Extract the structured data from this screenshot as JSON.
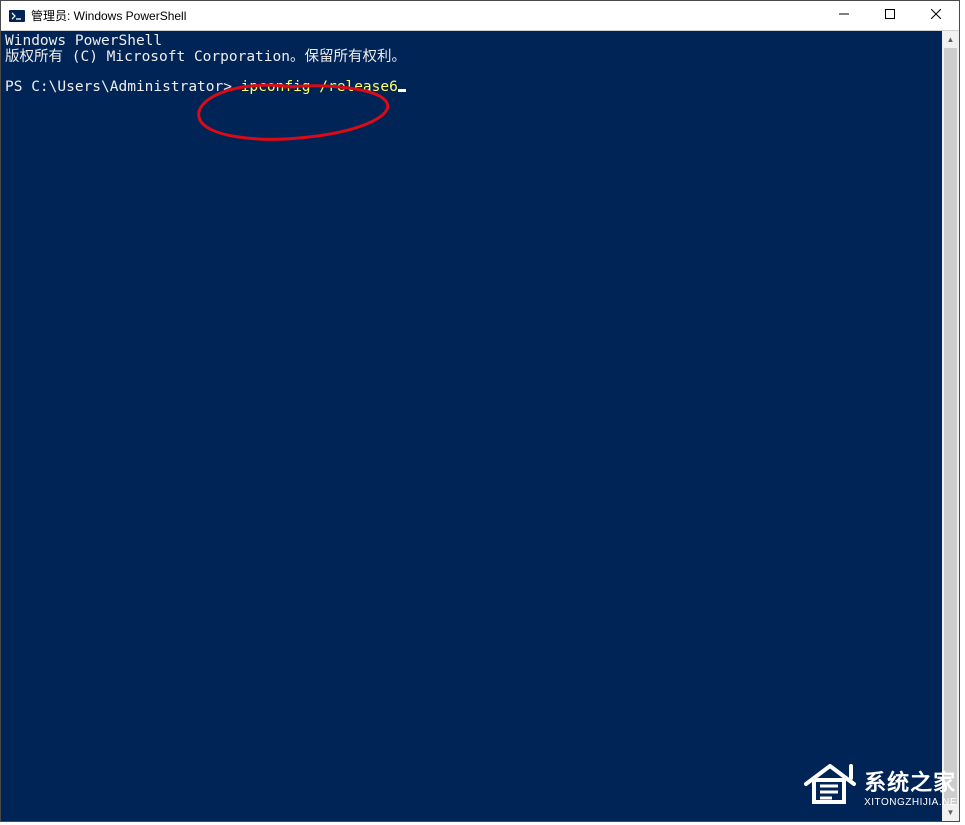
{
  "titlebar": {
    "title": "管理员: Windows PowerShell"
  },
  "terminal": {
    "header_line": "Windows PowerShell",
    "copyright_line": "版权所有 (C) Microsoft Corporation。保留所有权利。",
    "prompt": "PS C:\\Users\\Administrator> ",
    "command_part1": "ipconfig ",
    "command_part2": "/release6"
  },
  "annotation": {
    "color": "#d90b17"
  },
  "watermark": {
    "title": "系统之家",
    "subtitle": "XITONGZHIJIA.NE"
  },
  "colors": {
    "terminal_bg": "#012456",
    "command_color": "#ffff66"
  }
}
